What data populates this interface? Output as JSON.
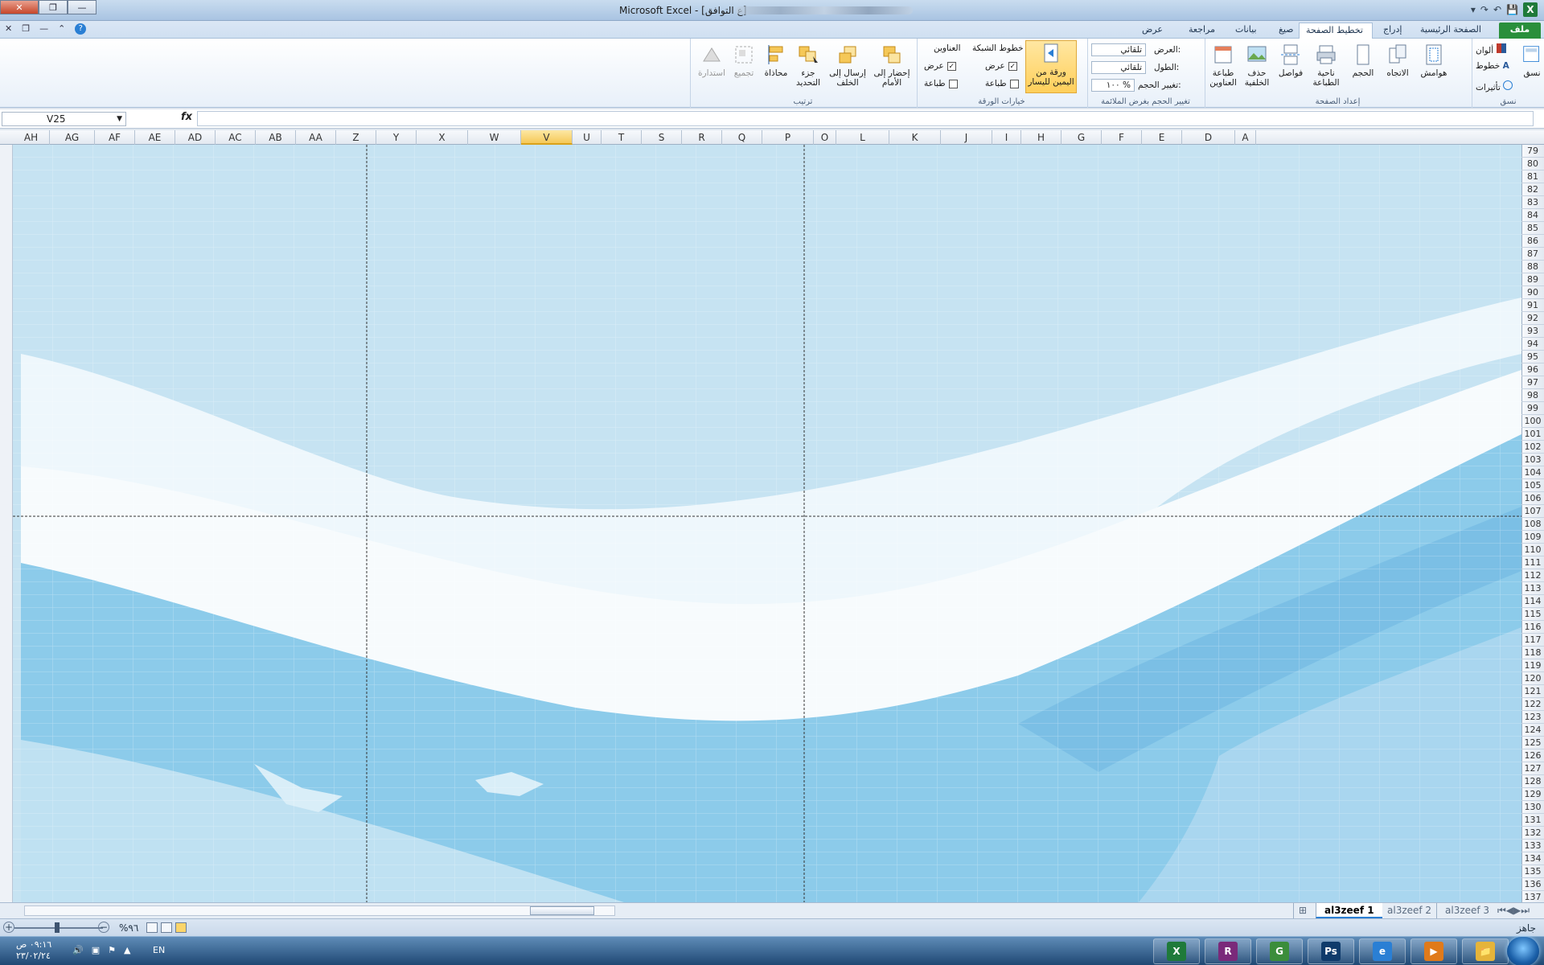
{
  "window": {
    "title": "Microsoft Excel - [ع التوافق]",
    "close_icon": "close-icon",
    "restore_icon": "restore-icon",
    "minimize_icon": "minimize-icon"
  },
  "qat": {
    "excel_icon": "X",
    "save": "💾",
    "undo": "↶",
    "redo": "↷",
    "customize": "▾"
  },
  "tabs": {
    "file": "ملف",
    "home": "الصفحة الرئيسية",
    "insert": "إدراج",
    "page_layout": "تخطيط الصفحة",
    "formulas": "صيغ",
    "data": "بيانات",
    "review": "مراجعة",
    "view": "عرض"
  },
  "ribbon": {
    "themes": {
      "group": "نسق",
      "themes_btn": "نسق",
      "colors": "ألوان",
      "fonts": "خطوط",
      "effects": "تأثيرات"
    },
    "page_setup": {
      "group": "إعداد الصفحة",
      "margins": "هوامش",
      "orientation": "الاتجاه",
      "size": "الحجم",
      "print_area": "ناحية الطباعة",
      "breaks": "فواصل",
      "background": "حذف الخلفية",
      "print_titles": "طباعة العناوين"
    },
    "scale": {
      "group": "تغيير الحجم بغرض الملائمة",
      "width_label": "العرض:",
      "width_value": "تلقائي",
      "height_label": "الطول:",
      "height_value": "تلقائي",
      "scale_label": "تغيير الحجم:",
      "scale_value": "١٠٠ %"
    },
    "sheet_options": {
      "group": "خيارات الورقة",
      "rtl": "ورقة من اليمين لليسار",
      "gridlines": "خطوط الشبكة",
      "gridlines_view": "عرض",
      "gridlines_print": "طباعة",
      "headings": "العناوين",
      "headings_view": "عرض",
      "headings_print": "طباعة",
      "check": "✓"
    },
    "arrange": {
      "group": "ترتيب",
      "bring_forward": "إحضار إلى الأمام",
      "send_backward": "إرسال إلى الخلف",
      "selection_pane": "جزء التحديد",
      "align": "محاذاة",
      "group_btn": "تجميع",
      "rotate": "استدارة"
    }
  },
  "formula_bar": {
    "name_box": "V25",
    "fx": "fx",
    "content": ""
  },
  "columns": [
    "AH",
    "AG",
    "AF",
    "AE",
    "AD",
    "AC",
    "AB",
    "AA",
    "Z",
    "Y",
    "X",
    "W",
    "V",
    "U",
    "T",
    "S",
    "R",
    "Q",
    "P",
    "O",
    "L",
    "K",
    "J",
    "I",
    "H",
    "G",
    "F",
    "E",
    "D",
    "A"
  ],
  "active_column": "V",
  "rows": [
    "79",
    "80",
    "81",
    "82",
    "83",
    "84",
    "85",
    "86",
    "87",
    "88",
    "89",
    "90",
    "91",
    "92",
    "93",
    "94",
    "95",
    "96",
    "97",
    "98",
    "99",
    "100",
    "101",
    "102",
    "103",
    "104",
    "105",
    "106",
    "107",
    "108",
    "109",
    "110",
    "111",
    "112",
    "113",
    "114",
    "115",
    "116",
    "117",
    "118",
    "119",
    "120",
    "121",
    "122",
    "123",
    "124",
    "125",
    "126",
    "127",
    "128",
    "129",
    "130",
    "131",
    "132",
    "133",
    "134",
    "135",
    "136",
    "137"
  ],
  "sheets": [
    {
      "name": "al3zeef 1",
      "active": true
    },
    {
      "name": "al3zeef 2",
      "active": false
    },
    {
      "name": "al3zeef 3",
      "active": false
    }
  ],
  "status": {
    "ready": "جاهز",
    "zoom": "%٩٦"
  },
  "taskbar": {
    "time": "٠٩:١٦ ص",
    "date": "٢٣/٠٢/٢٤",
    "lang": "EN",
    "apps": [
      {
        "name": "excel-icon",
        "label": "X",
        "color": "#1f7a3a"
      },
      {
        "name": "winrar-icon",
        "label": "R",
        "color": "#7a2a7a"
      },
      {
        "name": "chrome-icon",
        "label": "G",
        "color": "#3b8d3b"
      },
      {
        "name": "photoshop-icon",
        "label": "Ps",
        "color": "#0f3b6b"
      },
      {
        "name": "ie-icon",
        "label": "e",
        "color": "#2a7fd4"
      },
      {
        "name": "media-player-icon",
        "label": "▶",
        "color": "#e07a1a"
      },
      {
        "name": "explorer-icon",
        "label": "📁",
        "color": "#e5b43a"
      }
    ]
  },
  "colors": {
    "accent": "#2a8f3b",
    "sky_light": "#c6e3f2",
    "sky_mid": "#7fc2e6",
    "white_band": "#f4f9fc"
  }
}
